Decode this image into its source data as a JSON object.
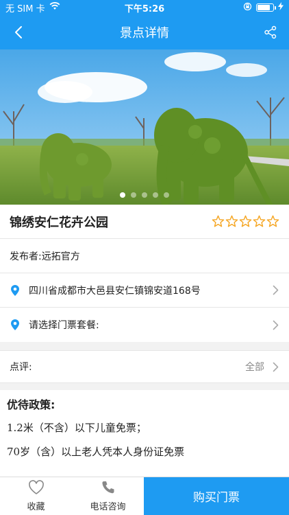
{
  "status_bar": {
    "carrier": "无 SIM 卡",
    "time": "下午5:26",
    "battery_level": 0.8
  },
  "nav": {
    "title": "景点详情",
    "back_icon": "chevron-left-icon",
    "share_icon": "share-icon"
  },
  "banner": {
    "image_alt": "Topiary elephants in park",
    "dots_count": 5,
    "active_dot": 0
  },
  "attraction": {
    "name": "锦绣安仁花卉公园",
    "rating": 0,
    "rating_max": 5
  },
  "publisher": {
    "text": "发布者:远拓官方"
  },
  "address": {
    "text": "四川省成都市大邑县安仁镇锦安道168号"
  },
  "ticket": {
    "text": "请选择门票套餐:"
  },
  "review": {
    "label": "点评:",
    "action": "全部"
  },
  "policy": {
    "title": "优待政策:",
    "lines": [
      "1.2米（不含）以下儿童免票；",
      "70岁（含）以上老人凭本人身份证免票"
    ]
  },
  "bottom_bar": {
    "favorite_label": "收藏",
    "phone_label": "电话咨询",
    "buy_label": "购买门票"
  },
  "colors": {
    "primary": "#1e9bf2",
    "star": "#f5a623"
  }
}
